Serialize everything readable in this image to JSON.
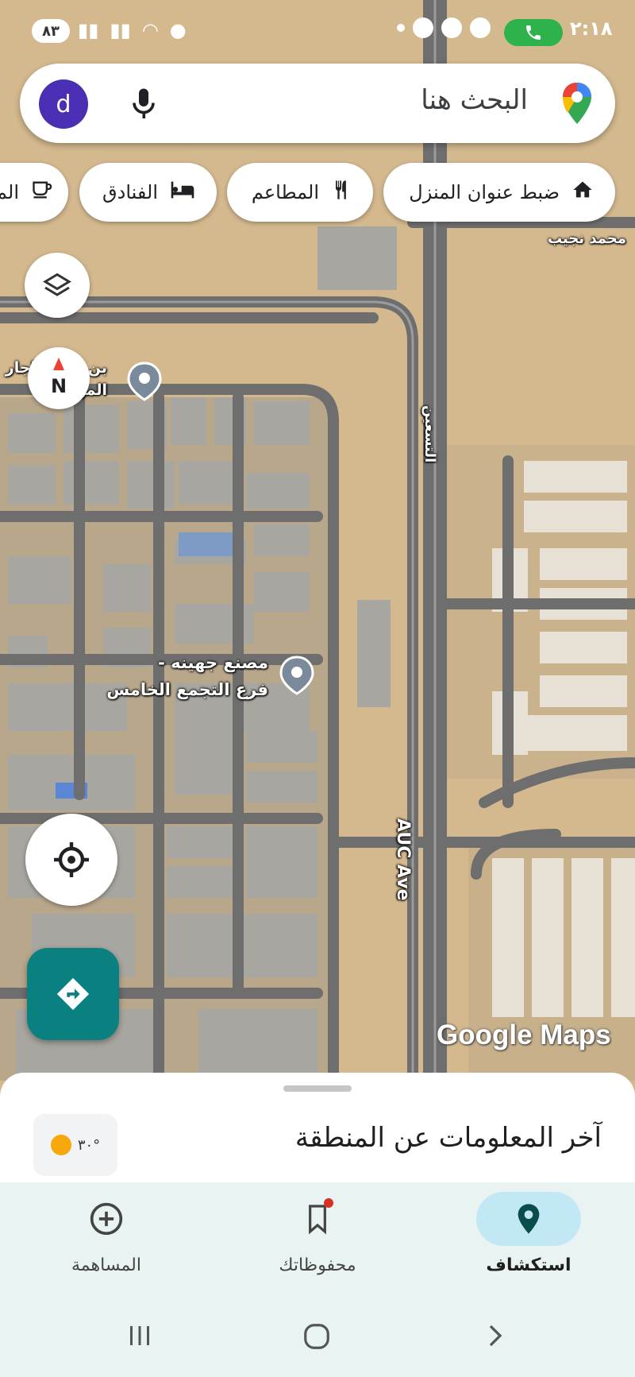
{
  "status_bar": {
    "time": "٢:١٨",
    "battery": "٨٣"
  },
  "search": {
    "placeholder": "البحث هنا",
    "avatar_letter": "d"
  },
  "chips": [
    {
      "label": "ضبط عنوان المنزل",
      "icon": "home-icon"
    },
    {
      "label": "المطاعم",
      "icon": "restaurant-icon"
    },
    {
      "label": "الفنادق",
      "icon": "hotel-icon"
    },
    {
      "label": "الم",
      "icon": "coffee-icon"
    }
  ],
  "map": {
    "street_labels": {
      "mohamed_naguib": "محمد نجيب",
      "auc_ave": "AUC Ave",
      "tesaeen": "التسعين"
    },
    "places": [
      {
        "name_line1": "بن و المحاجار",
        "name_line2": "الموا - ية"
      },
      {
        "name_line1": "مصنع جهينه -",
        "name_line2": "فرع التجمع الخامس"
      }
    ],
    "compass_letter": "N",
    "attribution": "Google Maps"
  },
  "sheet": {
    "title": "آخر المعلومات عن المنطقة",
    "temperature": "٣٠°"
  },
  "nav": {
    "items": [
      {
        "label": "استكشاف",
        "icon": "explore-pin-icon",
        "active": true
      },
      {
        "label": "محفوظاتك",
        "icon": "bookmark-icon",
        "active": false
      },
      {
        "label": "المساهمة",
        "icon": "add-circle-icon",
        "active": false
      }
    ]
  },
  "colors": {
    "accent_teal": "#0b8080",
    "nav_active_bg": "#c2e7f5",
    "call_green": "#2eb34c",
    "avatar_purple": "#4a2eb3"
  }
}
